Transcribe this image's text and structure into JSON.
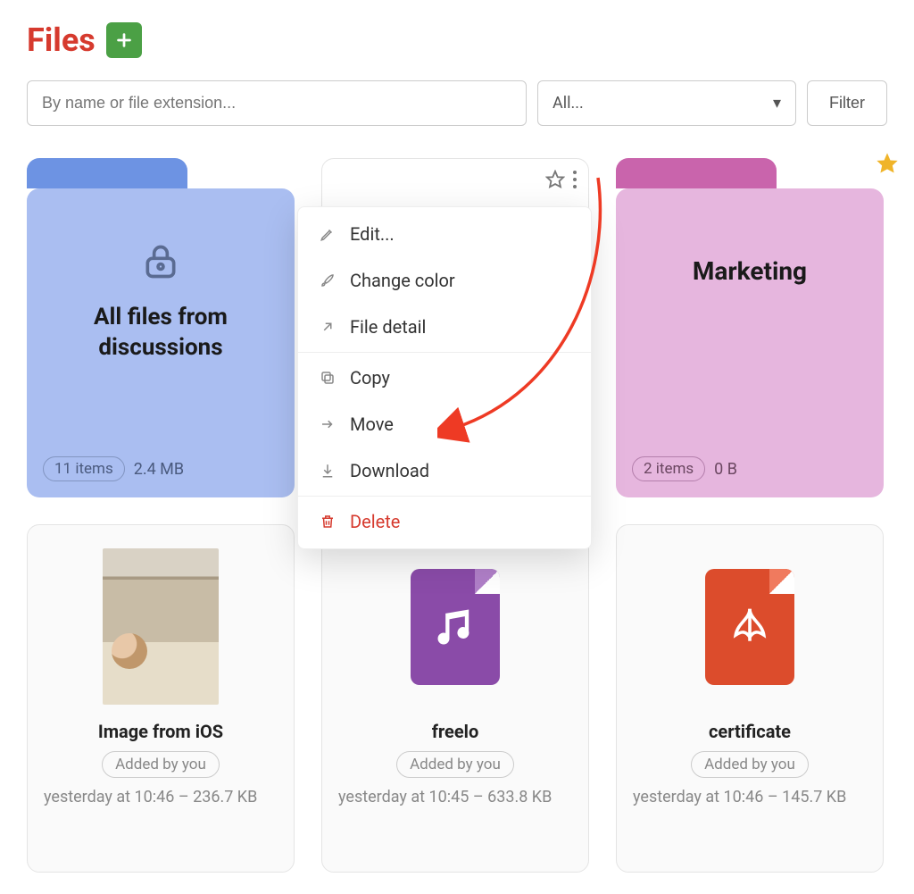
{
  "header": {
    "title": "Files"
  },
  "toolbar": {
    "search_placeholder": "By name or file extension...",
    "type_filter": "All...",
    "filter_button": "Filter"
  },
  "folders": {
    "all_files": {
      "title": "All files from discussions",
      "items_label": "11 items",
      "size": "2.4 MB"
    },
    "marketing": {
      "title": "Marketing",
      "items_label": "2 items",
      "size": "0 B",
      "starred": true
    }
  },
  "files": [
    {
      "name": "Image from iOS",
      "added_by": "Added by you",
      "meta": "yesterday at 10:46 – 236.7 KB",
      "kind": "image"
    },
    {
      "name": "freelo",
      "added_by": "Added by you",
      "meta": "yesterday at 10:45 – 633.8 KB",
      "kind": "audio"
    },
    {
      "name": "certificate",
      "added_by": "Added by you",
      "meta": "yesterday at 10:46 – 145.7 KB",
      "kind": "pdf"
    }
  ],
  "menu": {
    "edit": "Edit...",
    "change_color": "Change color",
    "file_detail": "File detail",
    "copy": "Copy",
    "move": "Move",
    "download": "Download",
    "delete": "Delete"
  },
  "colors": {
    "accent": "#d63a2e",
    "add_button": "#4ba045",
    "folder_blue": "#aabef1",
    "folder_pink": "#e6b6de",
    "star": "#f0b429",
    "audio_icon": "#8a4ba8",
    "pdf_icon": "#dc4c2c"
  }
}
